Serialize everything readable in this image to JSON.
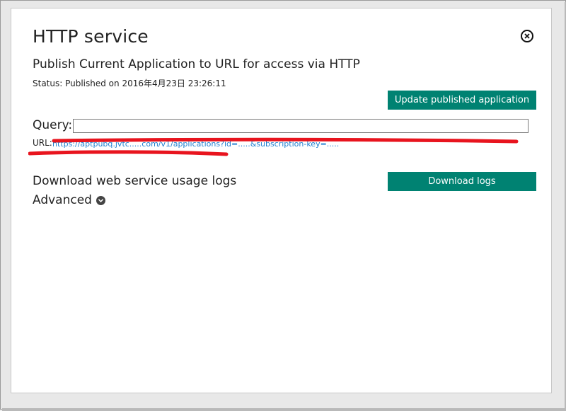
{
  "dialog": {
    "title": "HTTP service",
    "subtitle": "Publish Current Application to URL for access via HTTP",
    "status": "Status: Published on 2016年4月23日 23:26:11",
    "update_button": "Update published application",
    "query_label": "Query:",
    "query_value": "",
    "url_label": "URL:",
    "url_value": "https://aptpubq.jvtc.....com/v1/applications?id=.....&subscription-key=.....",
    "download_label": "Download web service usage logs",
    "download_button": "Download logs",
    "advanced_label": "Advanced"
  },
  "colors": {
    "accent": "#008272",
    "link": "#1f7fd0",
    "redaction": "#e8141e"
  },
  "icons": {
    "close": "close-circle-icon",
    "advanced": "chevron-down-circle-icon"
  }
}
